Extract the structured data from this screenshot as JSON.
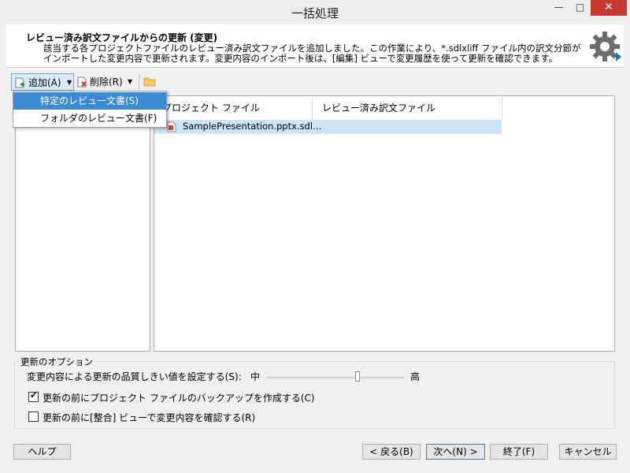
{
  "window": {
    "title": "一括処理",
    "controls": {
      "minimize": "—",
      "maximize": "□",
      "close": "✕"
    }
  },
  "header": {
    "title": "レビュー済み訳文ファイルからの更新 (変更)",
    "description": "該当する各プロジェクトファイルのレビュー済み訳文ファイルを追加しました。この作業により、*.sdlxliff ファイル内の訳文分節がインポートした変更内容で更新されます。変更内容のインポート後は、[編集] ビューで変更履歴を使って更新を確認できます。",
    "icon": "gear-icon"
  },
  "toolbar": {
    "add_label": "追加(A)",
    "remove_label": "削除(R)",
    "icons": [
      "add-file-icon",
      "remove-file-icon",
      "folder-icon"
    ]
  },
  "dropdown": {
    "items": [
      "特定のレビュー文書(S)",
      "フォルダのレビュー文書(F)"
    ]
  },
  "grid": {
    "columns": [
      "プロジェクト ファイル",
      "レビュー済み訳文ファイル"
    ],
    "rows": [
      {
        "project_file": "SamplePresentation.pptx.sdl…",
        "review_file": ""
      }
    ]
  },
  "options": {
    "legend": "更新のオプション",
    "threshold_label": "変更内容による更新の品質しきい値を設定する(S):",
    "slider_min": "中",
    "slider_max": "高",
    "checkbox1": {
      "label": "更新の前にプロジェクト ファイルのバックアップを作成する(C)",
      "checked": true
    },
    "checkbox2": {
      "label": "更新の前に[整合] ビューで変更内容を確認する(R)",
      "checked": false
    }
  },
  "footer": {
    "help": "ヘルプ",
    "back": "< 戻る(B)",
    "next": "次へ(N) >",
    "finish": "終了(F)",
    "cancel": "キャンセル"
  }
}
